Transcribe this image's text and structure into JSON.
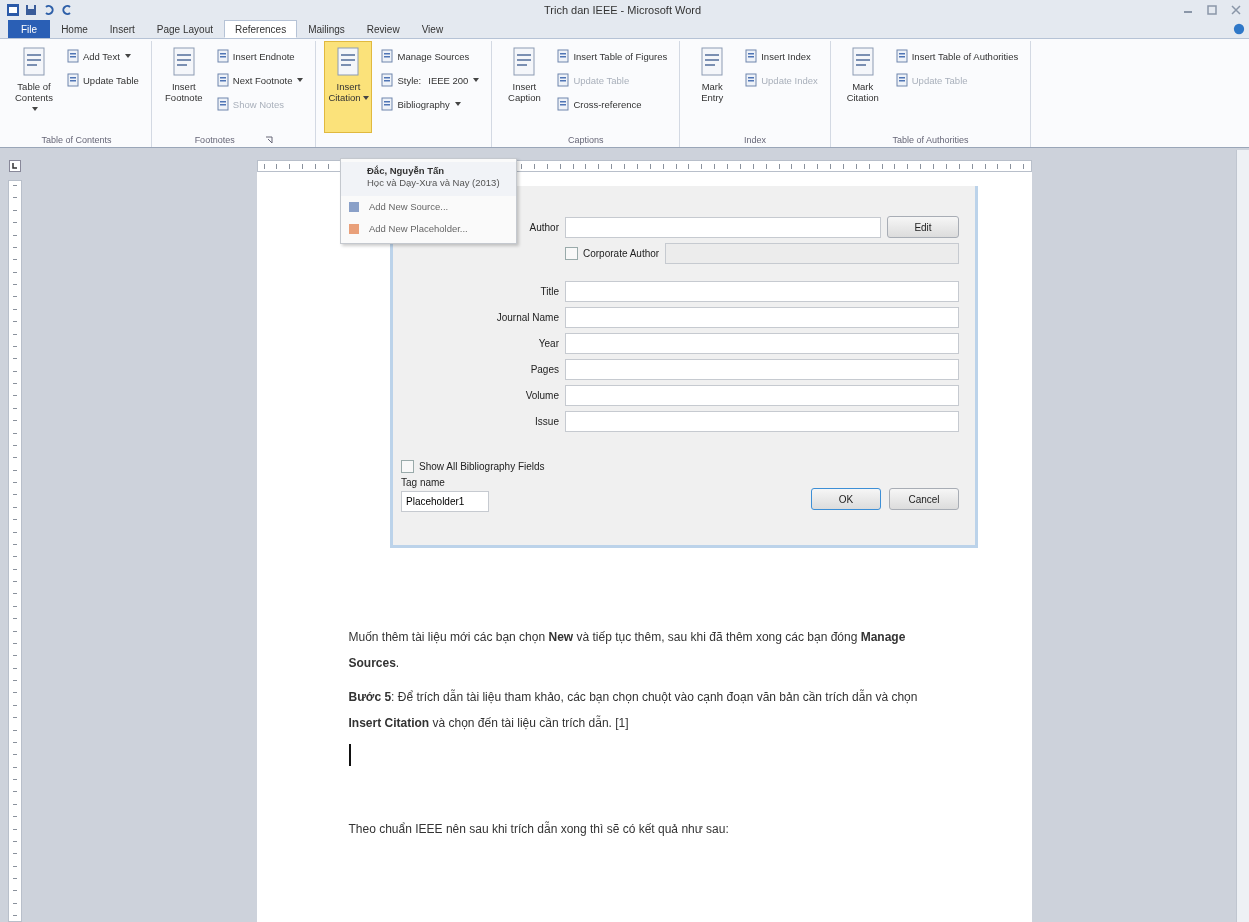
{
  "window": {
    "title": "Trich dan IEEE - Microsoft Word"
  },
  "tabs": [
    {
      "label": "File",
      "selected": false,
      "kind": "file"
    },
    {
      "label": "Home",
      "selected": false,
      "kind": "tab"
    },
    {
      "label": "Insert",
      "selected": false,
      "kind": "tab"
    },
    {
      "label": "Page Layout",
      "selected": false,
      "kind": "tab"
    },
    {
      "label": "References",
      "selected": true,
      "kind": "tab"
    },
    {
      "label": "Mailings",
      "selected": false,
      "kind": "tab"
    },
    {
      "label": "Review",
      "selected": false,
      "kind": "tab"
    },
    {
      "label": "View",
      "selected": false,
      "kind": "tab"
    }
  ],
  "ribbon": [
    {
      "name": "Table of Contents",
      "launcher": false,
      "items": [
        {
          "kind": "large",
          "label": "Table of Contents",
          "dropdown": true,
          "disabled": false,
          "active": false
        },
        {
          "kind": "small",
          "label": "Add Text",
          "dropdown": true,
          "disabled": false,
          "active": false
        },
        {
          "kind": "small",
          "label": "Update Table",
          "dropdown": false,
          "disabled": false,
          "active": false
        }
      ]
    },
    {
      "name": "Footnotes",
      "launcher": true,
      "items": [
        {
          "kind": "large",
          "label": "Insert Footnote",
          "dropdown": false,
          "disabled": false,
          "active": false
        },
        {
          "kind": "small",
          "label": "Insert Endnote",
          "dropdown": false,
          "disabled": false,
          "active": false
        },
        {
          "kind": "small",
          "label": "Next Footnote",
          "dropdown": true,
          "disabled": false,
          "active": false
        },
        {
          "kind": "small",
          "label": "Show Notes",
          "dropdown": false,
          "disabled": true,
          "active": false
        }
      ]
    },
    {
      "items": [
        {
          "kind": "large",
          "label": "Insert Citation",
          "dropdown": true,
          "disabled": false,
          "active": true
        },
        {
          "kind": "small",
          "label": "Manage Sources",
          "dropdown": false,
          "disabled": false,
          "active": false
        },
        {
          "kind": "small",
          "label": "Style:",
          "value": "IEEE 200",
          "dropdown": true,
          "disabled": false,
          "active": false
        },
        {
          "kind": "small",
          "label": "Bibliography",
          "dropdown": true,
          "disabled": false,
          "active": false
        }
      ]
    },
    {
      "name": "Captions",
      "launcher": false,
      "items": [
        {
          "kind": "large",
          "label": "Insert Caption",
          "dropdown": false,
          "disabled": false,
          "active": false
        },
        {
          "kind": "small",
          "label": "Insert Table of Figures",
          "dropdown": false,
          "disabled": false,
          "active": false
        },
        {
          "kind": "small",
          "label": "Update Table",
          "dropdown": false,
          "disabled": true,
          "active": false
        },
        {
          "kind": "small",
          "label": "Cross-reference",
          "dropdown": false,
          "disabled": false,
          "active": false
        }
      ]
    },
    {
      "name": "Index",
      "launcher": false,
      "items": [
        {
          "kind": "large",
          "label": "Mark Entry",
          "dropdown": false,
          "disabled": false,
          "active": false
        },
        {
          "kind": "small",
          "label": "Insert Index",
          "dropdown": false,
          "disabled": false,
          "active": false
        },
        {
          "kind": "small",
          "label": "Update Index",
          "dropdown": false,
          "disabled": true,
          "active": false
        }
      ]
    },
    {
      "name": "Table of Authorities",
      "launcher": false,
      "items": [
        {
          "kind": "large",
          "label": "Mark Citation",
          "dropdown": false,
          "disabled": false,
          "active": false
        },
        {
          "kind": "small",
          "label": "Insert Table of Authorities",
          "dropdown": false,
          "disabled": false,
          "active": false
        },
        {
          "kind": "small",
          "label": "Update Table",
          "dropdown": false,
          "disabled": true,
          "active": false
        }
      ]
    }
  ],
  "citation_menu": [
    {
      "kind": "source",
      "title": "Đắc, Nguyễn Tấn",
      "detail": "Học và Dạy-Xưa và Nay (2013)"
    },
    {
      "kind": "action",
      "label": "Add New Source..."
    },
    {
      "kind": "action",
      "label": "Add New Placeholder..."
    }
  ],
  "dialog": {
    "fields": [
      {
        "kind": "author",
        "label": "Author",
        "button": "Edit"
      },
      {
        "kind": "corporate",
        "label": "Corporate Author",
        "checked": false
      },
      {
        "kind": "text",
        "label": "Title"
      },
      {
        "kind": "text",
        "label": "Journal Name"
      },
      {
        "kind": "text",
        "label": "Year"
      },
      {
        "kind": "text",
        "label": "Pages"
      },
      {
        "kind": "text",
        "label": "Volume"
      },
      {
        "kind": "text",
        "label": "Issue"
      }
    ],
    "show_all": {
      "label": "Show All Bibliography Fields",
      "checked": false
    },
    "tag_label": "Tag name",
    "tag_value": "Placeholder1",
    "buttons": [
      "OK",
      "Cancel"
    ]
  },
  "document": {
    "paragraphs": [
      "Muốn thêm tài liệu mới các bạn chọn **New** và tiếp tục thêm, sau khi đã thêm xong các bạn đóng **Manage Sources**.",
      "**Bước 5**: Để trích dẫn tài liệu tham khảo, các bạn chọn chuột vào cạnh đoạn văn bản cần trích dẫn và chọn **Insert Citation** và chọn đến tài liệu cần trích dẫn. [1]"
    ],
    "after_cursor": "Theo chuẩn IEEE nên sau khi trích dẫn xong thì sẽ có kết quả như sau:"
  }
}
